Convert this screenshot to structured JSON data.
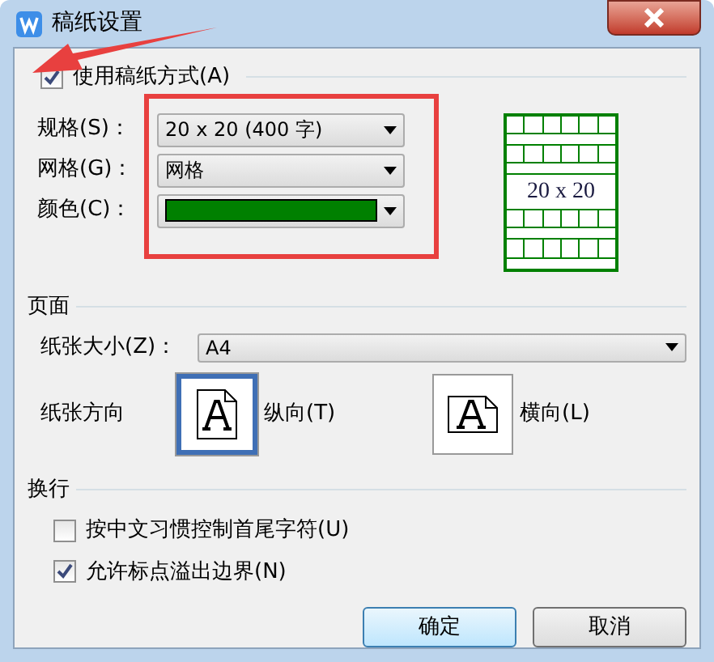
{
  "window": {
    "title": "稿纸设置"
  },
  "use_paper": {
    "label": "使用稿纸方式(A)",
    "checked": true
  },
  "fields": [
    {
      "kind": "text",
      "label": "规格(S)：",
      "value": "20 x 20 (400 字)"
    },
    {
      "kind": "text",
      "label": "网格(G)：",
      "value": "网格"
    },
    {
      "kind": "color",
      "label": "颜色(C)：",
      "color": "#008000"
    }
  ],
  "preview": {
    "text": "20 x 20"
  },
  "page": {
    "title": "页面",
    "size_label": "纸张大小(Z)：",
    "size_value": "A4",
    "orientation_label": "纸张方向",
    "orientations": [
      {
        "kind": "portrait",
        "label": "纵向(T)",
        "selected": true
      },
      {
        "kind": "landscape",
        "label": "横向(L)",
        "selected": false
      }
    ]
  },
  "wrap": {
    "title": "换行",
    "options": [
      {
        "label": "按中文习惯控制首尾字符(U)",
        "checked": false
      },
      {
        "label": "允许标点溢出边界(N)",
        "checked": true
      }
    ]
  },
  "buttons": [
    {
      "label": "确定",
      "selected": true
    },
    {
      "label": "取消",
      "selected": false
    }
  ]
}
